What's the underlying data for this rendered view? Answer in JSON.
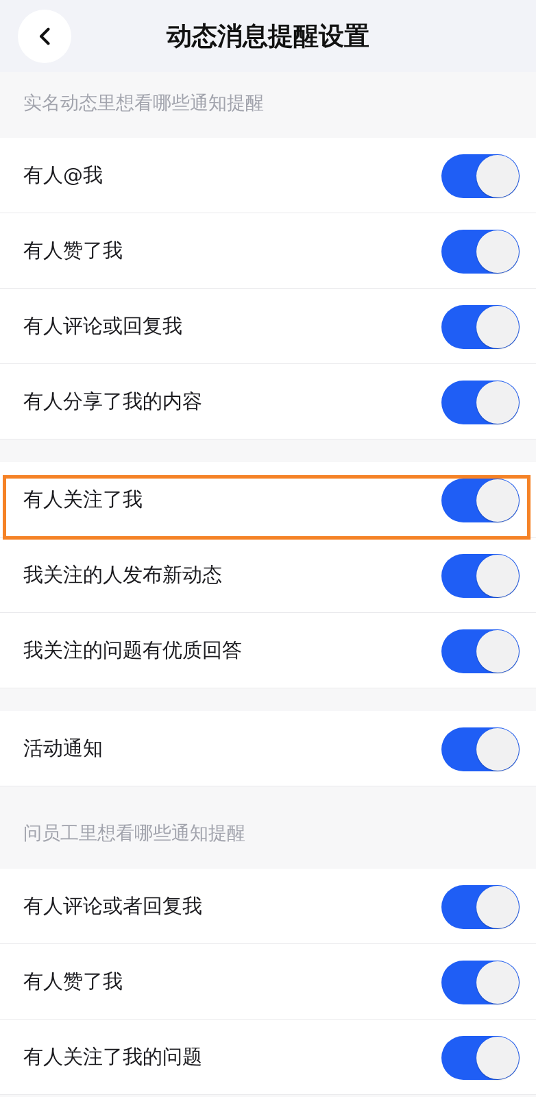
{
  "header": {
    "title": "动态消息提醒设置"
  },
  "sections": [
    {
      "title": "实名动态里想看哪些通知提醒",
      "groups": [
        {
          "items": [
            {
              "label": "有人@我",
              "on": true,
              "highlighted": false
            },
            {
              "label": "有人赞了我",
              "on": true,
              "highlighted": false
            },
            {
              "label": "有人评论或回复我",
              "on": true,
              "highlighted": false
            },
            {
              "label": "有人分享了我的内容",
              "on": true,
              "highlighted": false
            }
          ]
        },
        {
          "items": [
            {
              "label": "有人关注了我",
              "on": true,
              "highlighted": true
            },
            {
              "label": "我关注的人发布新动态",
              "on": true,
              "highlighted": false
            },
            {
              "label": "我关注的问题有优质回答",
              "on": true,
              "highlighted": false
            }
          ]
        },
        {
          "items": [
            {
              "label": "活动通知",
              "on": true,
              "highlighted": false
            }
          ]
        }
      ]
    },
    {
      "title": "问员工里想看哪些通知提醒",
      "groups": [
        {
          "items": [
            {
              "label": "有人评论或者回复我",
              "on": true,
              "highlighted": false
            },
            {
              "label": "有人赞了我",
              "on": true,
              "highlighted": false
            },
            {
              "label": "有人关注了我的问题",
              "on": true,
              "highlighted": false
            }
          ]
        }
      ]
    }
  ]
}
